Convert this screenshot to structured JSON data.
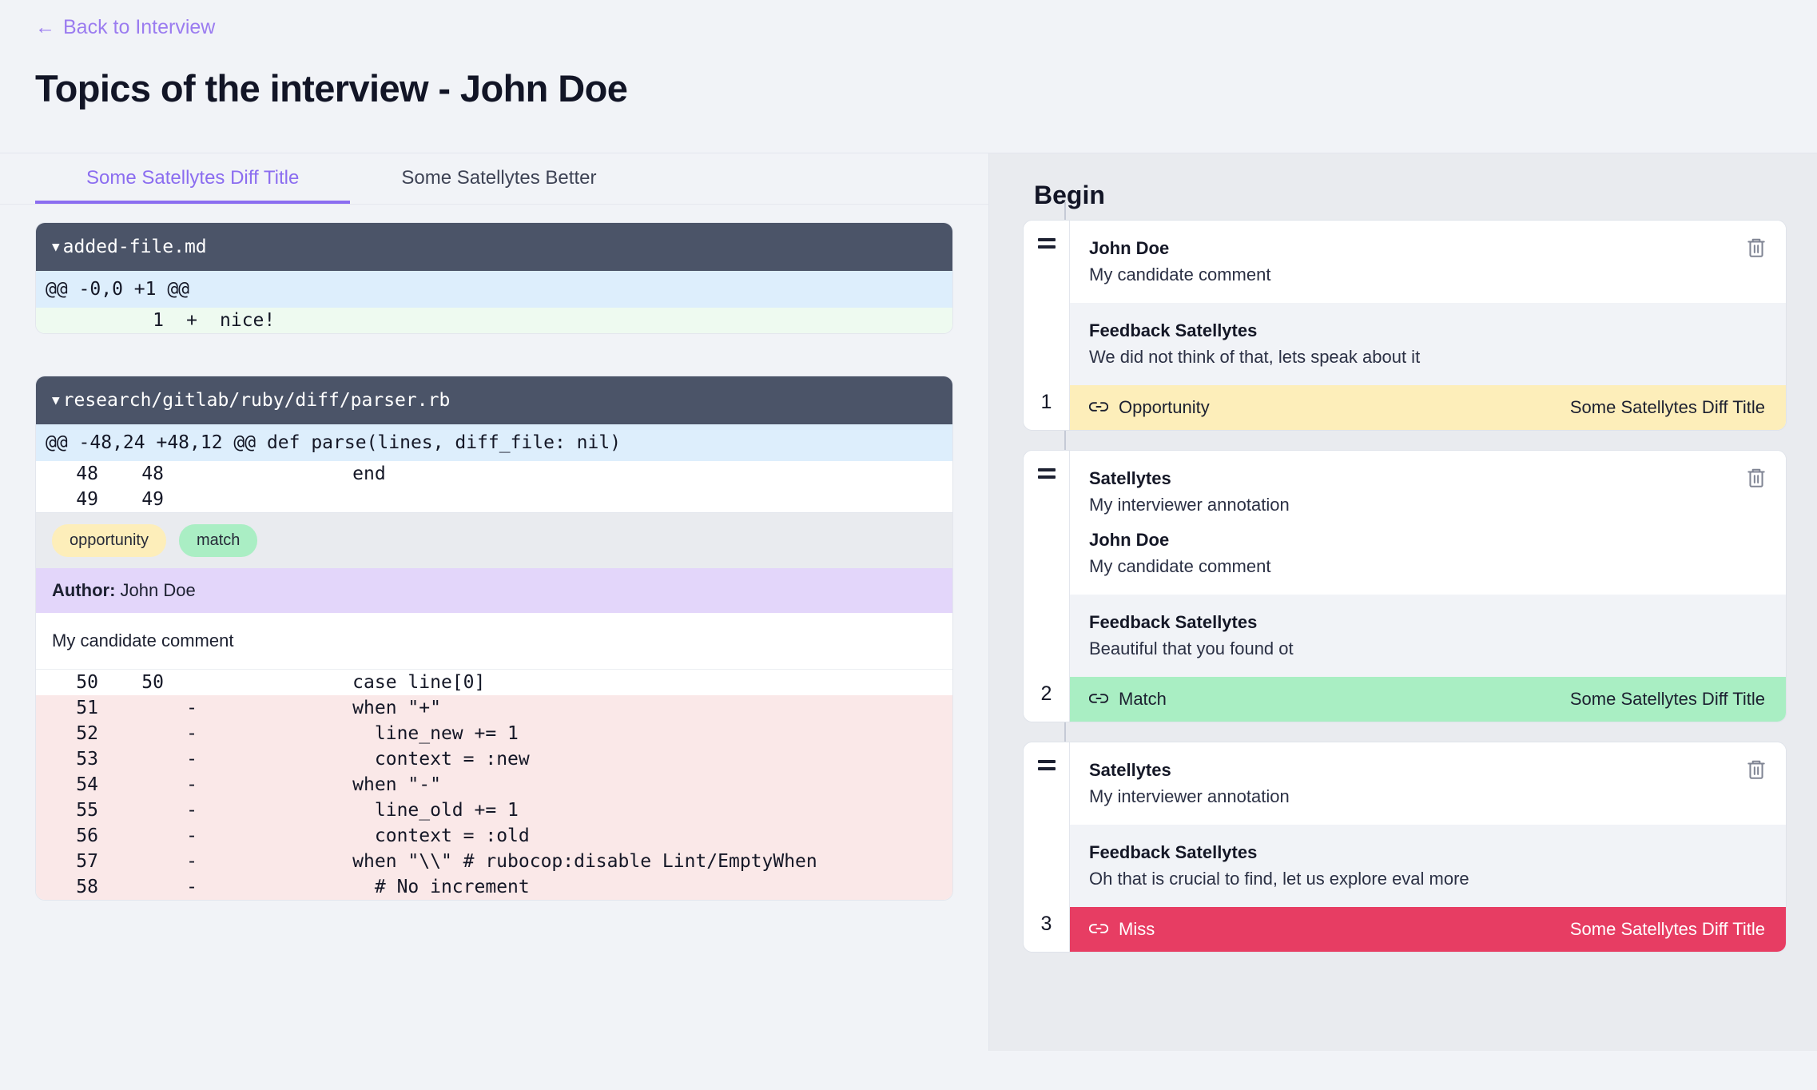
{
  "header": {
    "back_link": "Back to Interview",
    "back_arrow": "←",
    "title": "Topics of the interview - John Doe"
  },
  "tabs": [
    {
      "label": "Some Satellytes Diff Title",
      "active": true
    },
    {
      "label": "Some Satellytes Better",
      "active": false
    }
  ],
  "diffs": [
    {
      "filename": "added-file.md",
      "caret": "▼",
      "hunk": "@@ -0,0 +1 @@",
      "lines": [
        {
          "type": "add",
          "old": "",
          "new": "1",
          "sign": "+",
          "code": "nice!"
        }
      ],
      "tags": [],
      "annotation": null
    },
    {
      "filename": "research/gitlab/ruby/diff/parser.rb",
      "caret": "▼",
      "hunk": "@@ -48,24 +48,12 @@ def parse(lines, diff_file: nil)",
      "lines_before": [
        {
          "type": "ctx",
          "old": "48",
          "new": "48",
          "sign": "",
          "code": "            end"
        },
        {
          "type": "ctx",
          "old": "49",
          "new": "49",
          "sign": "",
          "code": ""
        }
      ],
      "tags": [
        {
          "label": "opportunity",
          "kind": "opportunity"
        },
        {
          "label": "match",
          "kind": "match"
        }
      ],
      "annotation": {
        "author_label": "Author:",
        "author_name": "John Doe",
        "comment": "My candidate comment"
      },
      "lines_after": [
        {
          "type": "ctx",
          "old": "50",
          "new": "50",
          "sign": "",
          "code": "            case line[0]"
        },
        {
          "type": "del",
          "old": "51",
          "new": "",
          "sign": "-",
          "code": "            when \"+\""
        },
        {
          "type": "del",
          "old": "52",
          "new": "",
          "sign": "-",
          "code": "              line_new += 1"
        },
        {
          "type": "del",
          "old": "53",
          "new": "",
          "sign": "-",
          "code": "              context = :new"
        },
        {
          "type": "del",
          "old": "54",
          "new": "",
          "sign": "-",
          "code": "            when \"-\""
        },
        {
          "type": "del",
          "old": "55",
          "new": "",
          "sign": "-",
          "code": "              line_old += 1"
        },
        {
          "type": "del",
          "old": "56",
          "new": "",
          "sign": "-",
          "code": "              context = :old"
        },
        {
          "type": "del",
          "old": "57",
          "new": "",
          "sign": "-",
          "code": "            when \"\\\\\" # rubocop:disable Lint/EmptyWhen"
        },
        {
          "type": "del",
          "old": "58",
          "new": "",
          "sign": "-",
          "code": "              # No increment"
        }
      ]
    }
  ],
  "timeline": {
    "title": "Begin",
    "cards": [
      {
        "index": "1",
        "delete_icon": "trash-icon",
        "entries": [
          {
            "name": "John Doe",
            "text": "My candidate comment",
            "bg": "white"
          }
        ],
        "feedback": {
          "name": "Feedback Satellytes",
          "text": "We did not think of that, lets speak about it"
        },
        "footer": {
          "kind": "opportunity",
          "icon": "link-icon",
          "label": "Opportunity",
          "source": "Some Satellytes Diff Title"
        }
      },
      {
        "index": "2",
        "delete_icon": "trash-icon",
        "entries": [
          {
            "name": "Satellytes",
            "text": "My interviewer annotation",
            "bg": "white"
          },
          {
            "name": "John Doe",
            "text": "My candidate comment",
            "bg": "white"
          }
        ],
        "feedback": {
          "name": "Feedback Satellytes",
          "text": "Beautiful that you found ot"
        },
        "footer": {
          "kind": "match",
          "icon": "link-icon",
          "label": "Match",
          "source": "Some Satellytes Diff Title"
        }
      },
      {
        "index": "3",
        "delete_icon": "trash-icon",
        "entries": [
          {
            "name": "Satellytes",
            "text": "My interviewer annotation",
            "bg": "white"
          }
        ],
        "feedback": {
          "name": "Feedback Satellytes",
          "text": "Oh that is crucial to find, let us explore eval more"
        },
        "footer": {
          "kind": "miss",
          "icon": "link-icon",
          "label": "Miss",
          "source": "Some Satellytes Diff Title"
        }
      }
    ]
  },
  "colors": {
    "accent": "#8b6df0",
    "opportunity": "#fdeeba",
    "match": "#a9eec3",
    "miss": "#e73d63",
    "diff_header": "#4b5468",
    "hunk": "#ddeefc",
    "deleted": "#fae8e8",
    "added": "#eefaf0",
    "author": "#e3d6fa"
  }
}
